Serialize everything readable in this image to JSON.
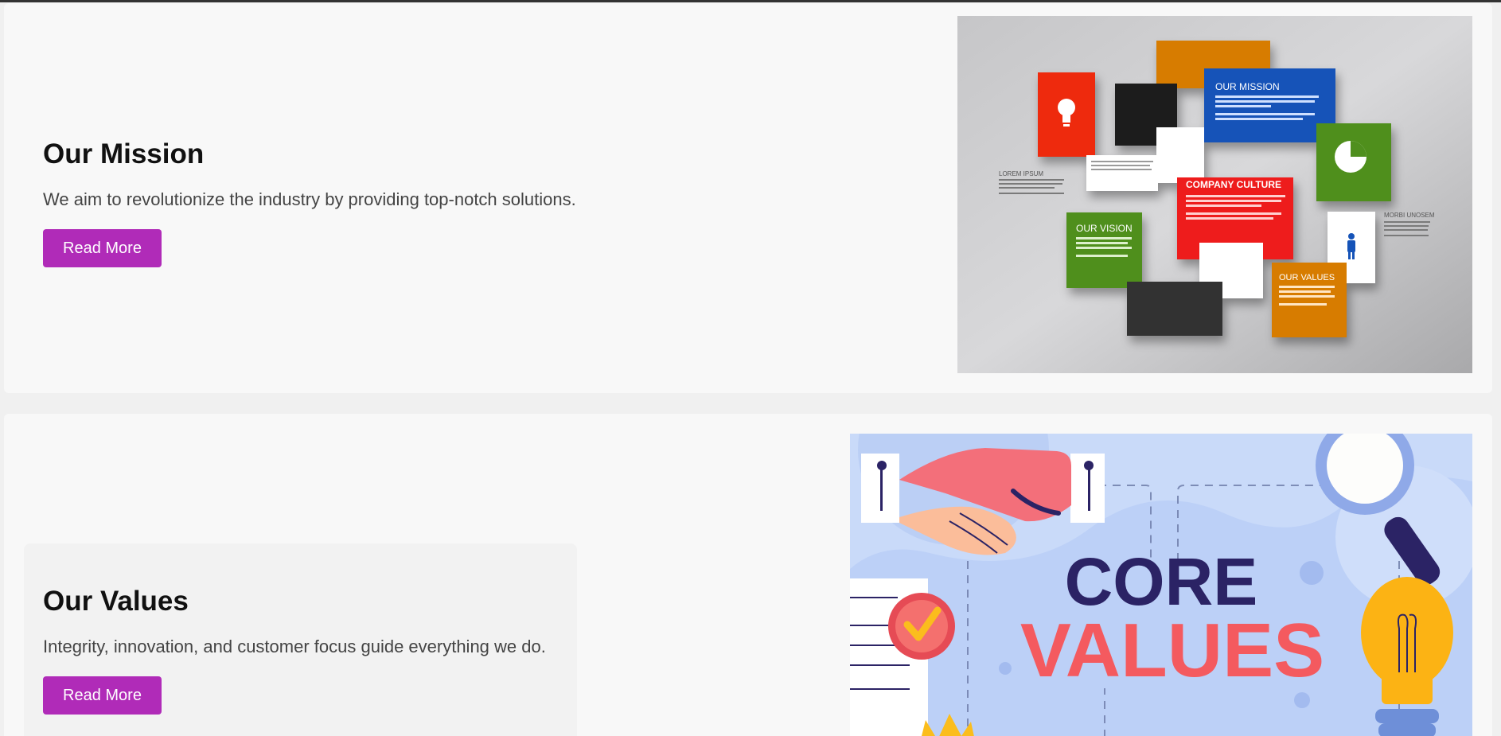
{
  "mission": {
    "title": "Our Mission",
    "description": "We aim to revolutionize the industry by providing top-notch solutions.",
    "button_label": "Read More",
    "image": {
      "heading_mission": "OUR MISSION",
      "heading_culture": "COMPANY CULTURE",
      "heading_vision": "OUR VISION",
      "heading_values": "OUR VALUES",
      "side_left": "LOREM IPSUM",
      "side_right": "MORBI UNOSEM"
    }
  },
  "values": {
    "title": "Our Values",
    "description": "Integrity, innovation, and customer focus guide everything we do.",
    "button_label": "Read More",
    "image": {
      "line1": "CORE",
      "line2": "VALUES"
    }
  },
  "colors": {
    "button": "#b02bb8",
    "background": "#f8f8f8"
  }
}
